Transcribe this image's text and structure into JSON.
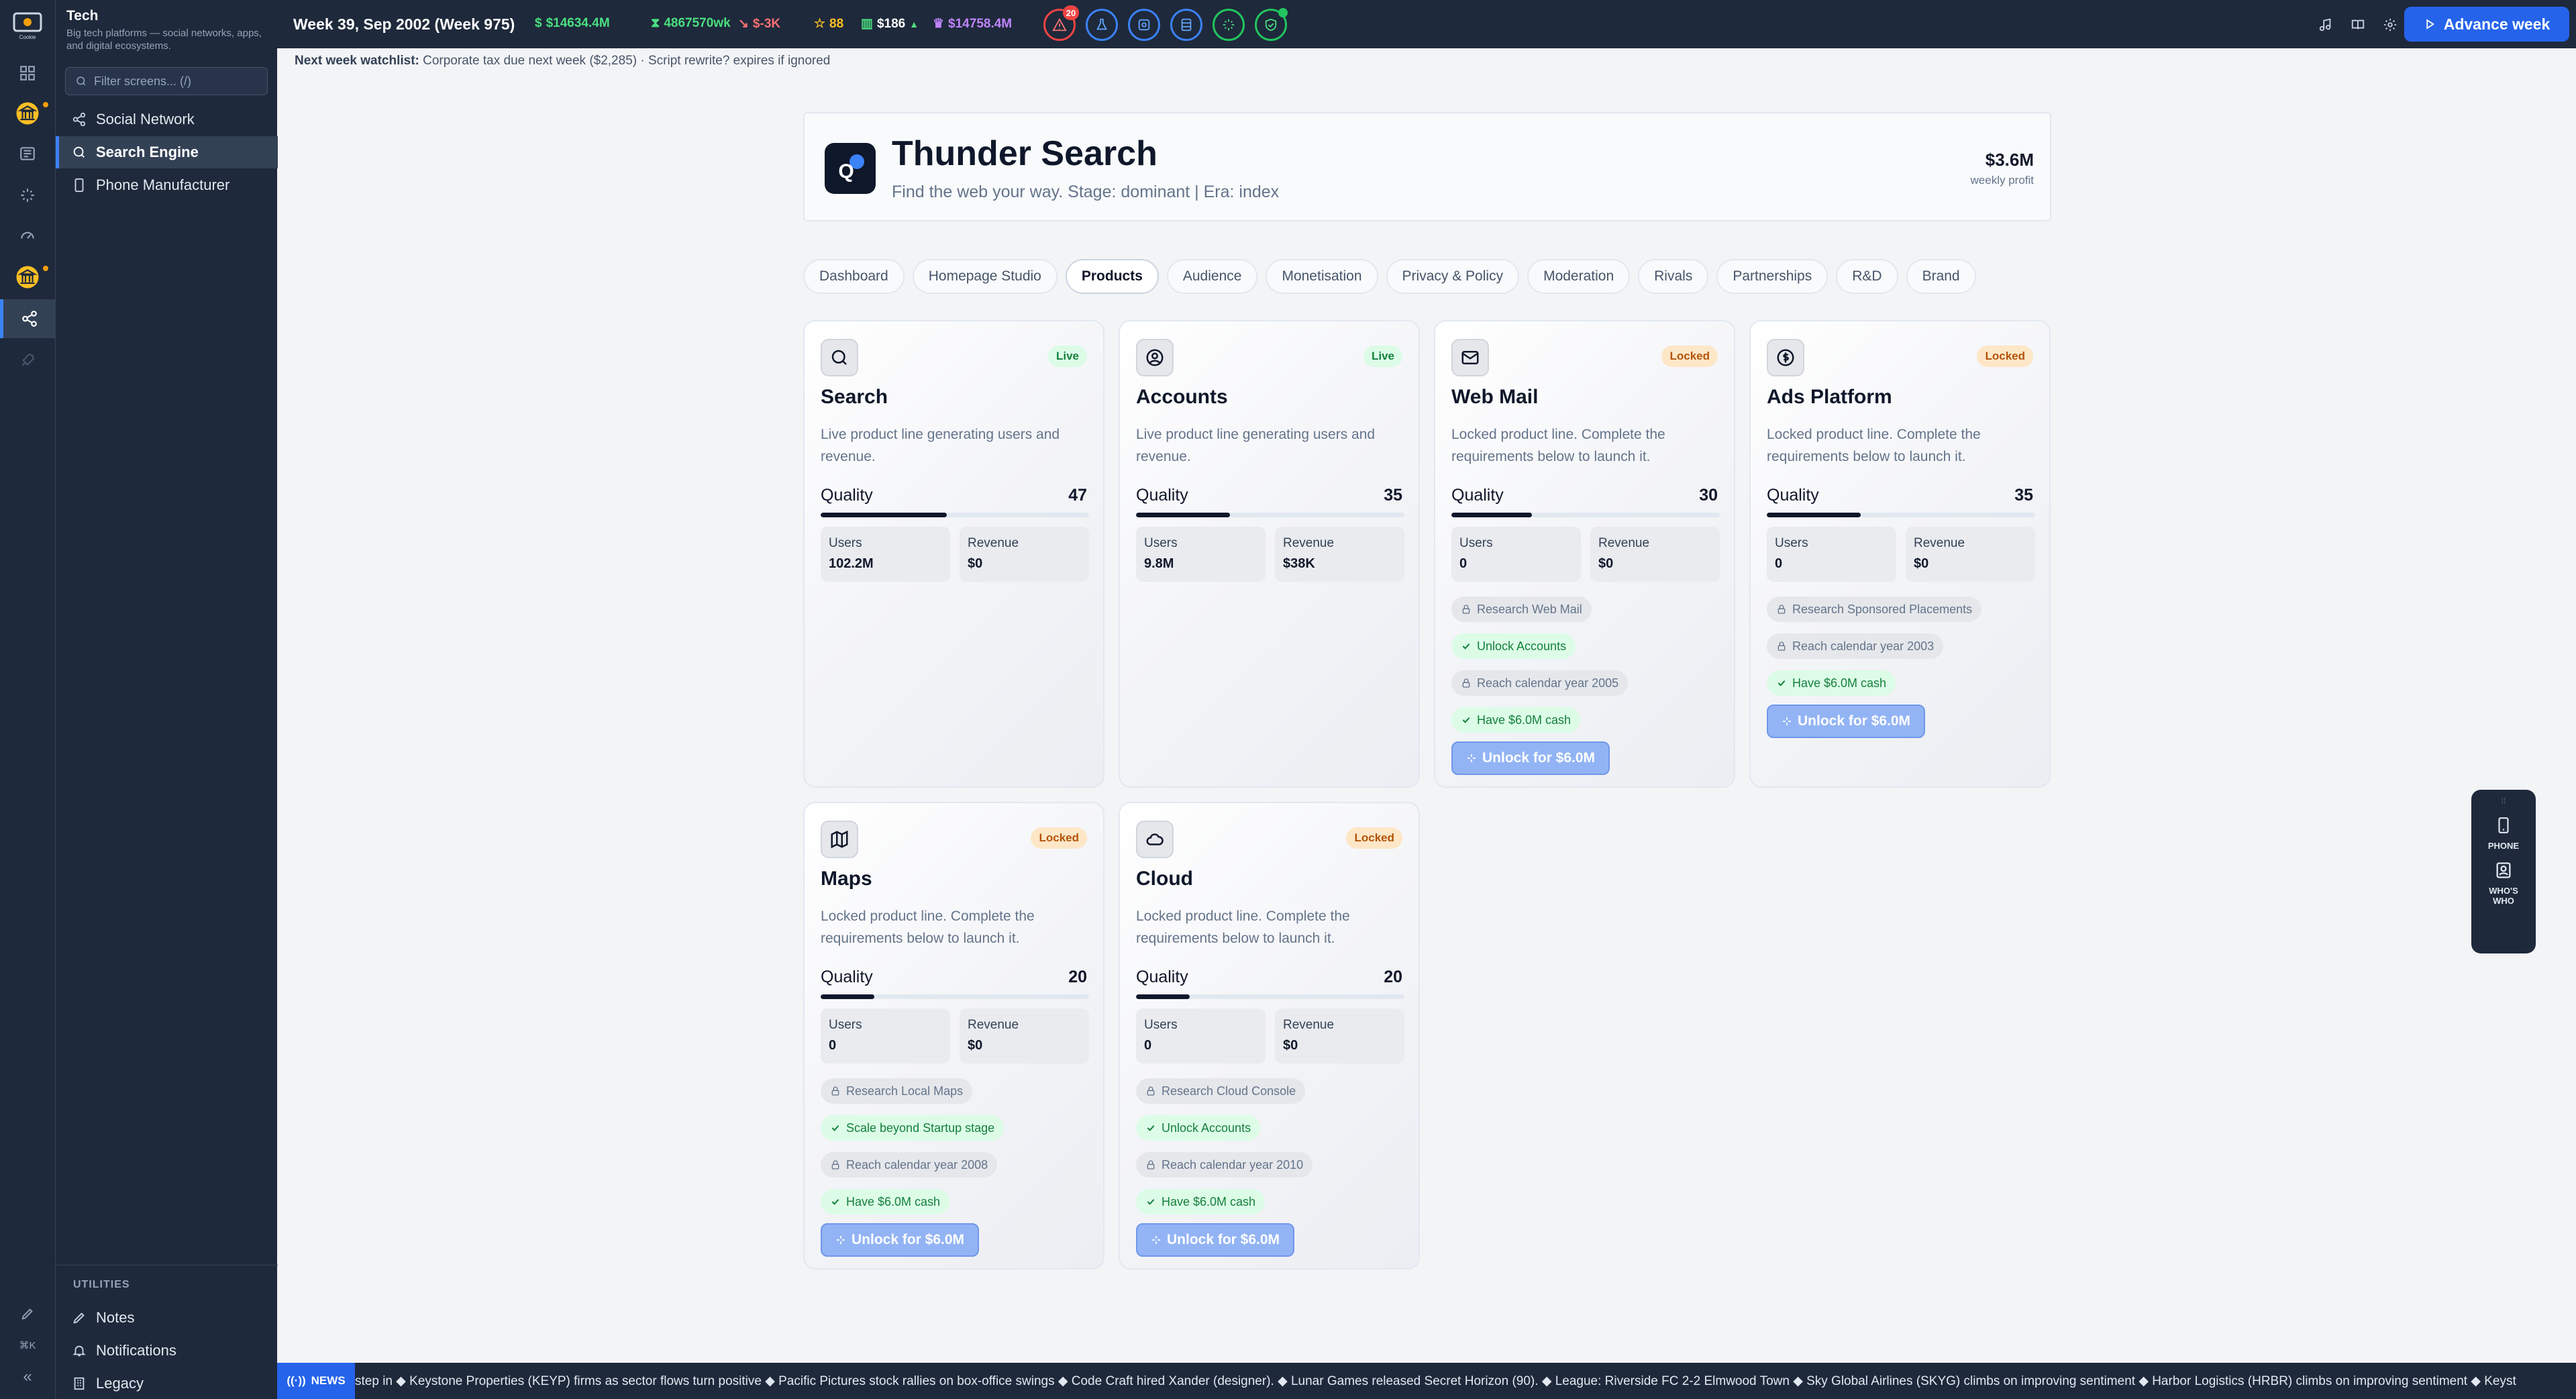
{
  "app": {
    "logo_text": "Cookie",
    "section_title": "Tech",
    "section_subtitle": "Big tech platforms — social networks, apps, and digital ecosystems."
  },
  "sidebar": {
    "filter_placeholder": "Filter screens... (/)",
    "items": [
      {
        "label": "Social Network",
        "icon": "share-icon"
      },
      {
        "label": "Search Engine",
        "icon": "search-icon",
        "active": true
      },
      {
        "label": "Phone Manufacturer",
        "icon": "phone-icon"
      }
    ],
    "utilities_heading": "UTILITIES",
    "utilities": [
      {
        "label": "Notes",
        "icon": "pencil-icon"
      },
      {
        "label": "Notifications",
        "icon": "bell-icon"
      },
      {
        "label": "Legacy",
        "icon": "building-icon"
      }
    ],
    "shortcut": "⌘K"
  },
  "topbar": {
    "week": "Week 39, Sep 2002 (Week 975)",
    "cash": "$14634.4M",
    "hourly": "4867570wk",
    "trend": "$-3K",
    "stars": "88",
    "stock": "$186",
    "networth": "$14758.4M",
    "alert_count": "20",
    "advance_label": "Advance week"
  },
  "watchlist": {
    "label": "Next week watchlist:",
    "text": "Corporate tax due next week ($2,285) · Script rewrite? expires if ignored"
  },
  "company": {
    "name": "Thunder Search",
    "tagline": "Find the web your way. Stage: dominant | Era: index",
    "profit": "$3.6M",
    "profit_label": "weekly profit"
  },
  "tabs": [
    "Dashboard",
    "Homepage Studio",
    "Products",
    "Audience",
    "Monetisation",
    "Privacy & Policy",
    "Moderation",
    "Rivals",
    "Partnerships",
    "R&D",
    "Brand"
  ],
  "active_tab": "Products",
  "products": [
    {
      "name": "Search",
      "icon": "search-icon",
      "status": "Live",
      "desc": "Live product line generating users and revenue.",
      "quality": 47,
      "users": "102.2M",
      "revenue": "$0",
      "reqs": []
    },
    {
      "name": "Accounts",
      "icon": "user-circle-icon",
      "status": "Live",
      "desc": "Live product line generating users and revenue.",
      "quality": 35,
      "users": "9.8M",
      "revenue": "$38K",
      "reqs": []
    },
    {
      "name": "Web Mail",
      "icon": "mail-icon",
      "status": "Locked",
      "desc": "Locked product line. Complete the requirements below to launch it.",
      "quality": 30,
      "users": "0",
      "revenue": "$0",
      "reqs": [
        {
          "text": "Research Web Mail",
          "done": false
        },
        {
          "text": "Unlock Accounts",
          "done": true
        },
        {
          "text": "Reach calendar year 2005",
          "done": false
        },
        {
          "text": "Have $6.0M cash",
          "done": true
        }
      ],
      "unlock": "Unlock for $6.0M"
    },
    {
      "name": "Ads Platform",
      "icon": "dollar-icon",
      "status": "Locked",
      "desc": "Locked product line. Complete the requirements below to launch it.",
      "quality": 35,
      "users": "0",
      "revenue": "$0",
      "reqs": [
        {
          "text": "Research Sponsored Placements",
          "done": false
        },
        {
          "text": "Reach calendar year 2003",
          "done": false
        },
        {
          "text": "Have $6.0M cash",
          "done": true
        }
      ],
      "unlock": "Unlock for $6.0M"
    },
    {
      "name": "Maps",
      "icon": "map-icon",
      "status": "Locked",
      "desc": "Locked product line. Complete the requirements below to launch it.",
      "quality": 20,
      "users": "0",
      "revenue": "$0",
      "reqs": [
        {
          "text": "Research Local Maps",
          "done": false
        },
        {
          "text": "Scale beyond Startup stage",
          "done": true
        },
        {
          "text": "Reach calendar year 2008",
          "done": false
        },
        {
          "text": "Have $6.0M cash",
          "done": true
        }
      ],
      "unlock": "Unlock for $6.0M"
    },
    {
      "name": "Cloud",
      "icon": "cloud-icon",
      "status": "Locked",
      "desc": "Locked product line. Complete the requirements below to launch it.",
      "quality": 20,
      "users": "0",
      "revenue": "$0",
      "reqs": [
        {
          "text": "Research Cloud Console",
          "done": false
        },
        {
          "text": "Unlock Accounts",
          "done": true
        },
        {
          "text": "Reach calendar year 2010",
          "done": false
        },
        {
          "text": "Have $6.0M cash",
          "done": true
        }
      ],
      "unlock": "Unlock for $6.0M"
    }
  ],
  "labels": {
    "quality": "Quality",
    "users": "Users",
    "revenue": "Revenue"
  },
  "float_widget": {
    "phone": "PHONE",
    "whos_who": "WHO'S WHO"
  },
  "news": {
    "label": "NEWS",
    "ticker": "step in ◆ Keystone Properties (KEYP) firms as sector flows turn positive ◆ Pacific Pictures stock rallies on box-office swings ◆ Code Craft hired Xander (designer). ◆ Lunar Games released Secret Horizon (90). ◆ League: Riverside FC 2-2 Elmwood Town ◆ Sky Global Airlines (SKYG) climbs on improving sentiment ◆ Harbor Logistics (HRBR) climbs on improving sentiment ◆ Keyst"
  },
  "colors": {
    "accent": "#2563eb",
    "live": "#15803d",
    "locked": "#b45309",
    "dark": "#1e293b"
  }
}
